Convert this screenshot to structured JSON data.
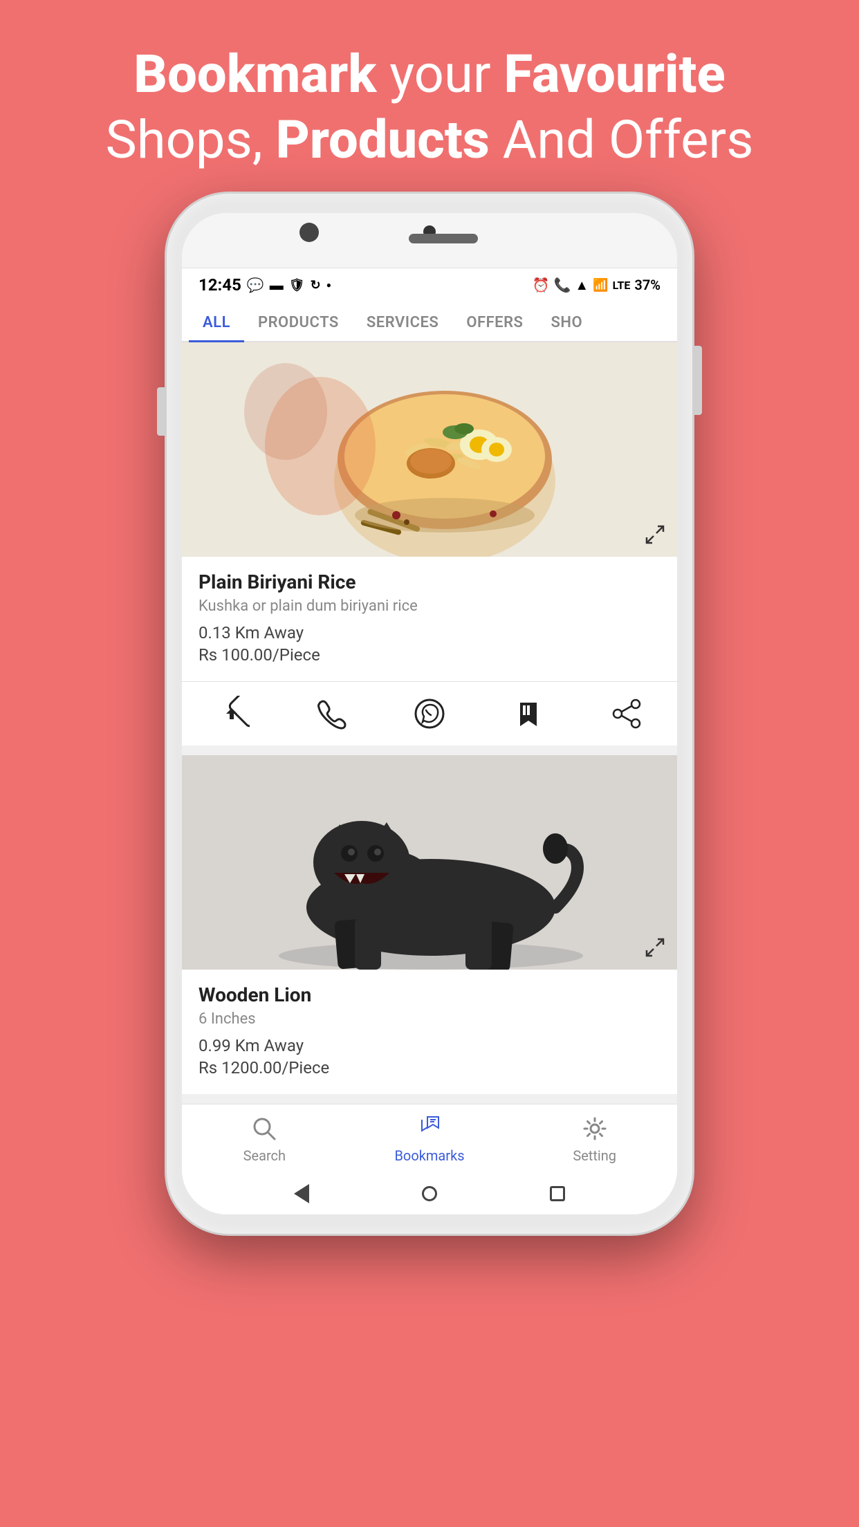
{
  "header": {
    "line1_regular": "your ",
    "line1_bold": "Favourite",
    "line1_prefix": "Bookmark",
    "line2_bold": "Products",
    "line2_regular": " And Offers",
    "line2_prefix": "Shops, "
  },
  "status_bar": {
    "time": "12:45",
    "battery": "37%"
  },
  "tabs": [
    {
      "label": "ALL",
      "active": true
    },
    {
      "label": "PRODUCTS",
      "active": false
    },
    {
      "label": "SERVICES",
      "active": false
    },
    {
      "label": "OFFERS",
      "active": false
    },
    {
      "label": "SHO",
      "active": false
    }
  ],
  "products": [
    {
      "title": "Plain Biriyani Rice",
      "subtitle": "Kushka or plain dum biriyani rice",
      "distance": "0.13 Km Away",
      "price": "Rs 100.00/Piece"
    },
    {
      "title": "Wooden Lion",
      "subtitle": "6 Inches",
      "distance": "0.99 Km Away",
      "price": "Rs 1200.00/Piece"
    }
  ],
  "bottom_nav": [
    {
      "label": "Search",
      "active": false
    },
    {
      "label": "Bookmarks",
      "active": true
    },
    {
      "label": "Setting",
      "active": false
    }
  ],
  "actions": [
    "directions",
    "phone",
    "whatsapp",
    "bookmark",
    "share"
  ]
}
